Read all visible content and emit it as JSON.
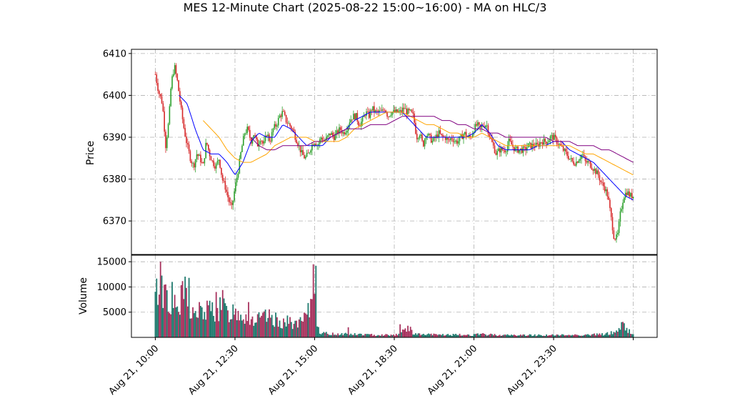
{
  "chart_data": {
    "type": "candlestick",
    "title": "MES 12-Minute Chart (2025-08-22 15:00~16:00) - MA on HLC/3",
    "price_panel": {
      "ylabel": "Price",
      "ylim": [
        6362,
        6411
      ],
      "yticks": [
        6370,
        6380,
        6390,
        6400,
        6410
      ],
      "grid": true
    },
    "volume_panel": {
      "ylabel": "Volume",
      "ylim": [
        0,
        16300
      ],
      "yticks": [
        5000,
        10000,
        15000
      ],
      "grid": true
    },
    "xlim": [
      -3,
      63
    ],
    "xticks": [
      {
        "x": 0,
        "label": "Aug 21, 10:00"
      },
      {
        "x": 10,
        "label": "Aug 21, 12:30"
      },
      {
        "x": 20,
        "label": "Aug 21, 15:00"
      },
      {
        "x": 30,
        "label": "Aug 21, 18:30"
      },
      {
        "x": 40,
        "label": "Aug 21, 21:00"
      },
      {
        "x": 50,
        "label": "Aug 21, 23:30"
      },
      {
        "x": 60,
        "label": ""
      }
    ],
    "colors": {
      "up": "#2ca02c",
      "down": "#d62728",
      "ma_fast": "#0000ff",
      "ma_mid": "#ffa500",
      "ma_slow": "#800080",
      "volume_up": "#1f7a6e",
      "volume_down": "#a8335e",
      "grid": "#b0b0b0"
    },
    "close_path": [
      [
        0,
        6405
      ],
      [
        0.4,
        6401
      ],
      [
        0.9,
        6398
      ],
      [
        1.3,
        6388
      ],
      [
        1.7,
        6394
      ],
      [
        2.0,
        6403
      ],
      [
        2.4,
        6407
      ],
      [
        2.8,
        6403
      ],
      [
        3.2,
        6397
      ],
      [
        3.6,
        6392
      ],
      [
        4.0,
        6388
      ],
      [
        4.4,
        6385
      ],
      [
        4.8,
        6383
      ],
      [
        5.2,
        6386
      ],
      [
        5.6,
        6385
      ],
      [
        6.0,
        6383
      ],
      [
        6.4,
        6389
      ],
      [
        6.8,
        6386
      ],
      [
        7.2,
        6384
      ],
      [
        7.6,
        6383
      ],
      [
        8.0,
        6385
      ],
      [
        8.4,
        6380
      ],
      [
        8.8,
        6378
      ],
      [
        9.2,
        6375
      ],
      [
        9.6,
        6373
      ],
      [
        10.0,
        6378
      ],
      [
        10.4,
        6382
      ],
      [
        10.8,
        6387
      ],
      [
        11.2,
        6391
      ],
      [
        11.6,
        6392
      ],
      [
        12.0,
        6389
      ],
      [
        12.4,
        6391
      ],
      [
        12.8,
        6388
      ],
      [
        13.2,
        6390
      ],
      [
        13.6,
        6388
      ],
      [
        14.0,
        6391
      ],
      [
        14.4,
        6389
      ],
      [
        14.8,
        6392
      ],
      [
        15.2,
        6393
      ],
      [
        15.6,
        6395
      ],
      [
        16.0,
        6396
      ],
      [
        16.4,
        6394
      ],
      [
        16.8,
        6393
      ],
      [
        17.2,
        6392
      ],
      [
        17.6,
        6390
      ],
      [
        18.0,
        6388
      ],
      [
        18.4,
        6386
      ],
      [
        18.8,
        6385
      ],
      [
        19.2,
        6386
      ],
      [
        19.6,
        6388
      ],
      [
        20.0,
        6389
      ],
      [
        20.4,
        6388
      ],
      [
        20.8,
        6390
      ],
      [
        21.2,
        6389
      ],
      [
        21.6,
        6390
      ],
      [
        22.0,
        6391
      ],
      [
        22.4,
        6390
      ],
      [
        22.8,
        6391
      ],
      [
        23.2,
        6392
      ],
      [
        23.6,
        6391
      ],
      [
        24.0,
        6392
      ],
      [
        24.4,
        6394
      ],
      [
        24.8,
        6395
      ],
      [
        25.2,
        6395
      ],
      [
        25.6,
        6393
      ],
      [
        26.0,
        6394
      ],
      [
        26.4,
        6396
      ],
      [
        26.8,
        6395
      ],
      [
        27.2,
        6397
      ],
      [
        27.6,
        6396
      ],
      [
        28.0,
        6396
      ],
      [
        28.4,
        6396
      ],
      [
        28.8,
        6397
      ],
      [
        29.2,
        6395
      ],
      [
        29.6,
        6396
      ],
      [
        30.0,
        6396
      ],
      [
        30.4,
        6396
      ],
      [
        30.8,
        6396
      ],
      [
        31.2,
        6397
      ],
      [
        31.6,
        6396
      ],
      [
        32.0,
        6396
      ],
      [
        32.4,
        6395
      ],
      [
        32.8,
        6390
      ],
      [
        33.2,
        6391
      ],
      [
        33.6,
        6388
      ],
      [
        34.0,
        6391
      ],
      [
        34.4,
        6390
      ],
      [
        34.8,
        6389
      ],
      [
        35.2,
        6390
      ],
      [
        35.6,
        6391
      ],
      [
        36.0,
        6390
      ],
      [
        36.4,
        6390
      ],
      [
        36.8,
        6389
      ],
      [
        37.2,
        6390
      ],
      [
        37.6,
        6389
      ],
      [
        38.0,
        6389
      ],
      [
        38.4,
        6390
      ],
      [
        38.8,
        6391
      ],
      [
        39.2,
        6390
      ],
      [
        39.6,
        6390
      ],
      [
        40.0,
        6392
      ],
      [
        40.4,
        6393
      ],
      [
        40.8,
        6392
      ],
      [
        41.2,
        6393
      ],
      [
        41.6,
        6393
      ],
      [
        42.0,
        6390
      ],
      [
        42.4,
        6388
      ],
      [
        42.8,
        6386
      ],
      [
        43.2,
        6387
      ],
      [
        43.6,
        6387
      ],
      [
        44.0,
        6387
      ],
      [
        44.4,
        6389
      ],
      [
        44.8,
        6388
      ],
      [
        45.2,
        6387
      ],
      [
        45.6,
        6387
      ],
      [
        46.0,
        6387
      ],
      [
        46.4,
        6387
      ],
      [
        46.8,
        6388
      ],
      [
        47.2,
        6388
      ],
      [
        47.6,
        6388
      ],
      [
        48.0,
        6388
      ],
      [
        48.4,
        6389
      ],
      [
        48.8,
        6389
      ],
      [
        49.2,
        6389
      ],
      [
        49.6,
        6390
      ],
      [
        50.0,
        6390
      ],
      [
        50.4,
        6389
      ],
      [
        50.8,
        6388
      ],
      [
        51.2,
        6387
      ],
      [
        51.6,
        6386
      ],
      [
        52.0,
        6385
      ],
      [
        52.4,
        6384
      ],
      [
        52.8,
        6384
      ],
      [
        53.2,
        6385
      ],
      [
        53.6,
        6386
      ],
      [
        54.0,
        6384
      ],
      [
        54.4,
        6384
      ],
      [
        54.8,
        6383
      ],
      [
        55.2,
        6382
      ],
      [
        55.6,
        6381
      ],
      [
        56.0,
        6379
      ],
      [
        56.4,
        6378
      ],
      [
        56.8,
        6376
      ],
      [
        57.2,
        6371
      ],
      [
        57.6,
        6366
      ],
      [
        58.0,
        6366
      ],
      [
        58.4,
        6372
      ],
      [
        58.8,
        6376
      ],
      [
        59.2,
        6377
      ],
      [
        59.6,
        6376
      ],
      [
        60.0,
        6376
      ]
    ],
    "ma_fast": [
      [
        3,
        6400
      ],
      [
        4,
        6398
      ],
      [
        5,
        6392
      ],
      [
        6,
        6387
      ],
      [
        7,
        6386
      ],
      [
        8,
        6386
      ],
      [
        9,
        6384
      ],
      [
        10,
        6381
      ],
      [
        11,
        6384
      ],
      [
        12,
        6389
      ],
      [
        13,
        6391
      ],
      [
        14,
        6390
      ],
      [
        15,
        6390
      ],
      [
        16,
        6393
      ],
      [
        17,
        6392
      ],
      [
        18,
        6390
      ],
      [
        19,
        6388
      ],
      [
        20,
        6388
      ],
      [
        21,
        6388
      ],
      [
        22,
        6390
      ],
      [
        23,
        6391
      ],
      [
        24,
        6392
      ],
      [
        25,
        6394
      ],
      [
        26,
        6395
      ],
      [
        27,
        6396
      ],
      [
        28,
        6396
      ],
      [
        29,
        6396
      ],
      [
        30,
        6396
      ],
      [
        31,
        6396
      ],
      [
        32,
        6394
      ],
      [
        33,
        6392
      ],
      [
        34,
        6390
      ],
      [
        35,
        6390
      ],
      [
        36,
        6390
      ],
      [
        37,
        6390
      ],
      [
        38,
        6390
      ],
      [
        39,
        6390
      ],
      [
        40,
        6391
      ],
      [
        41,
        6393
      ],
      [
        42,
        6391
      ],
      [
        43,
        6388
      ],
      [
        44,
        6387
      ],
      [
        45,
        6387
      ],
      [
        46,
        6387
      ],
      [
        47,
        6387
      ],
      [
        48,
        6388
      ],
      [
        49,
        6388
      ],
      [
        50,
        6389
      ],
      [
        51,
        6389
      ],
      [
        52,
        6387
      ],
      [
        53,
        6386
      ],
      [
        54,
        6385
      ],
      [
        55,
        6384
      ],
      [
        56,
        6382
      ],
      [
        57,
        6380
      ],
      [
        58,
        6378
      ],
      [
        59,
        6376
      ],
      [
        60,
        6375
      ]
    ],
    "ma_mid": [
      [
        6,
        6394
      ],
      [
        7,
        6392
      ],
      [
        8,
        6390
      ],
      [
        9,
        6387
      ],
      [
        10,
        6385
      ],
      [
        11,
        6384
      ],
      [
        12,
        6384
      ],
      [
        13,
        6385
      ],
      [
        14,
        6386
      ],
      [
        15,
        6388
      ],
      [
        16,
        6389
      ],
      [
        17,
        6390
      ],
      [
        18,
        6390
      ],
      [
        19,
        6390
      ],
      [
        20,
        6389
      ],
      [
        21,
        6389
      ],
      [
        22,
        6389
      ],
      [
        23,
        6389
      ],
      [
        24,
        6390
      ],
      [
        25,
        6392
      ],
      [
        26,
        6393
      ],
      [
        27,
        6394
      ],
      [
        28,
        6395
      ],
      [
        29,
        6396
      ],
      [
        30,
        6396
      ],
      [
        31,
        6396
      ],
      [
        32,
        6395
      ],
      [
        33,
        6394
      ],
      [
        34,
        6393
      ],
      [
        35,
        6393
      ],
      [
        36,
        6392
      ],
      [
        37,
        6391
      ],
      [
        38,
        6391
      ],
      [
        39,
        6390
      ],
      [
        40,
        6390
      ],
      [
        41,
        6391
      ],
      [
        42,
        6390
      ],
      [
        43,
        6389
      ],
      [
        44,
        6388
      ],
      [
        45,
        6388
      ],
      [
        46,
        6388
      ],
      [
        47,
        6388
      ],
      [
        48,
        6388
      ],
      [
        49,
        6388
      ],
      [
        50,
        6388
      ],
      [
        51,
        6388
      ],
      [
        52,
        6388
      ],
      [
        53,
        6387
      ],
      [
        54,
        6386
      ],
      [
        55,
        6386
      ],
      [
        56,
        6385
      ],
      [
        57,
        6384
      ],
      [
        58,
        6383
      ],
      [
        59,
        6382
      ],
      [
        60,
        6381
      ]
    ],
    "ma_slow": [
      [
        12,
        6390
      ],
      [
        13,
        6388
      ],
      [
        14,
        6387
      ],
      [
        15,
        6387
      ],
      [
        16,
        6388
      ],
      [
        17,
        6388
      ],
      [
        18,
        6388
      ],
      [
        19,
        6388
      ],
      [
        20,
        6389
      ],
      [
        21,
        6389
      ],
      [
        22,
        6390
      ],
      [
        23,
        6391
      ],
      [
        24,
        6392
      ],
      [
        25,
        6392
      ],
      [
        26,
        6392
      ],
      [
        27,
        6393
      ],
      [
        28,
        6393
      ],
      [
        29,
        6393
      ],
      [
        30,
        6394
      ],
      [
        31,
        6395
      ],
      [
        32,
        6395
      ],
      [
        33,
        6395
      ],
      [
        34,
        6395
      ],
      [
        35,
        6395
      ],
      [
        36,
        6394
      ],
      [
        37,
        6394
      ],
      [
        38,
        6393
      ],
      [
        39,
        6393
      ],
      [
        40,
        6392
      ],
      [
        41,
        6392
      ],
      [
        42,
        6391
      ],
      [
        43,
        6391
      ],
      [
        44,
        6390
      ],
      [
        45,
        6390
      ],
      [
        46,
        6390
      ],
      [
        47,
        6390
      ],
      [
        48,
        6390
      ],
      [
        49,
        6390
      ],
      [
        50,
        6389
      ],
      [
        51,
        6389
      ],
      [
        52,
        6389
      ],
      [
        53,
        6388
      ],
      [
        54,
        6388
      ],
      [
        55,
        6388
      ],
      [
        56,
        6387
      ],
      [
        57,
        6387
      ],
      [
        58,
        6386
      ],
      [
        59,
        6385
      ],
      [
        60,
        6384
      ]
    ],
    "volume_knots": [
      [
        0,
        7500
      ],
      [
        0.5,
        11000
      ],
      [
        1,
        9000
      ],
      [
        1.5,
        8500
      ],
      [
        2,
        7000
      ],
      [
        2.5,
        6000
      ],
      [
        3,
        5500
      ],
      [
        3.5,
        9000
      ],
      [
        4,
        8500
      ],
      [
        4.5,
        5000
      ],
      [
        5,
        4500
      ],
      [
        6,
        5000
      ],
      [
        7,
        5500
      ],
      [
        8,
        5000
      ],
      [
        8.5,
        7000
      ],
      [
        9,
        4500
      ],
      [
        10,
        5500
      ],
      [
        11,
        4500
      ],
      [
        12,
        3500
      ],
      [
        13,
        3500
      ],
      [
        14,
        4000
      ],
      [
        15,
        3500
      ],
      [
        16,
        3000
      ],
      [
        17,
        3000
      ],
      [
        18,
        2500
      ],
      [
        19,
        4000
      ],
      [
        19.5,
        6000
      ],
      [
        20,
        11000
      ],
      [
        20.3,
        4000
      ],
      [
        20.6,
        1200
      ],
      [
        21,
        800
      ],
      [
        22,
        700
      ],
      [
        23,
        700
      ],
      [
        24,
        700
      ],
      [
        25,
        600
      ],
      [
        26,
        600
      ],
      [
        27,
        500
      ],
      [
        28,
        500
      ],
      [
        29,
        500
      ],
      [
        30,
        500
      ],
      [
        31,
        1000
      ],
      [
        31.5,
        2000
      ],
      [
        32,
        1500
      ],
      [
        32.5,
        800
      ],
      [
        33,
        600
      ],
      [
        34,
        550
      ],
      [
        35,
        550
      ],
      [
        36,
        550
      ],
      [
        37,
        500
      ],
      [
        38,
        500
      ],
      [
        39,
        500
      ],
      [
        40,
        500
      ],
      [
        41,
        600
      ],
      [
        42,
        550
      ],
      [
        43,
        500
      ],
      [
        44,
        450
      ],
      [
        45,
        450
      ],
      [
        46,
        450
      ],
      [
        47,
        450
      ],
      [
        48,
        450
      ],
      [
        49,
        450
      ],
      [
        50,
        450
      ],
      [
        51,
        450
      ],
      [
        52,
        500
      ],
      [
        53,
        500
      ],
      [
        54,
        500
      ],
      [
        55,
        550
      ],
      [
        56,
        600
      ],
      [
        57,
        800
      ],
      [
        58,
        1200
      ],
      [
        58.5,
        2500
      ],
      [
        59,
        2000
      ],
      [
        59.5,
        1200
      ],
      [
        60,
        800
      ]
    ],
    "volume_spikes": [
      [
        0.6,
        15000
      ],
      [
        1.3,
        10500
      ],
      [
        2.1,
        11000
      ],
      [
        4.3,
        11800
      ],
      [
        3.8,
        9500
      ],
      [
        7.7,
        9000
      ],
      [
        5.6,
        7000
      ],
      [
        11.7,
        7000
      ],
      [
        19.9,
        14500
      ],
      [
        20.1,
        14200
      ],
      [
        30.7,
        2600
      ],
      [
        24.2,
        2000
      ],
      [
        58.6,
        3000
      ]
    ]
  }
}
